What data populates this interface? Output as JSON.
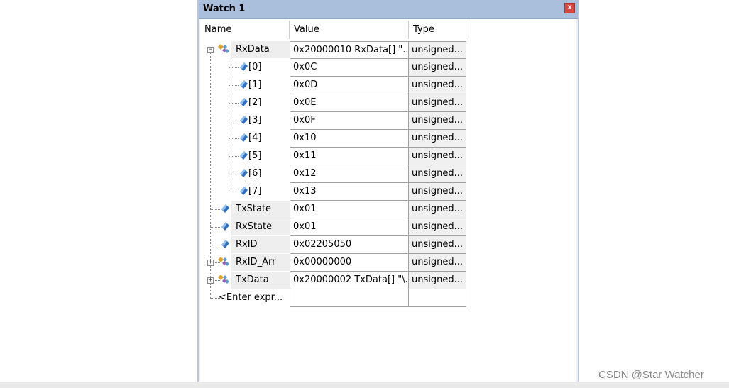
{
  "window": {
    "title": "Watch 1",
    "close_label": "x"
  },
  "columns": {
    "name": "Name",
    "value": "Value",
    "type": "Type"
  },
  "rows": [
    {
      "name": "RxData",
      "value": "0x20000010 RxData[] \"...",
      "type": "unsigned...",
      "kind": "struct",
      "level": 0,
      "expander": "minus"
    },
    {
      "name": "[0]",
      "value": "0x0C",
      "type": "unsigned...",
      "kind": "var",
      "level": 1
    },
    {
      "name": "[1]",
      "value": "0x0D",
      "type": "unsigned...",
      "kind": "var",
      "level": 1
    },
    {
      "name": "[2]",
      "value": "0x0E",
      "type": "unsigned...",
      "kind": "var",
      "level": 1
    },
    {
      "name": "[3]",
      "value": "0x0F",
      "type": "unsigned...",
      "kind": "var",
      "level": 1
    },
    {
      "name": "[4]",
      "value": "0x10",
      "type": "unsigned...",
      "kind": "var",
      "level": 1
    },
    {
      "name": "[5]",
      "value": "0x11",
      "type": "unsigned...",
      "kind": "var",
      "level": 1
    },
    {
      "name": "[6]",
      "value": "0x12",
      "type": "unsigned...",
      "kind": "var",
      "level": 1
    },
    {
      "name": "[7]",
      "value": "0x13",
      "type": "unsigned...",
      "kind": "var",
      "level": 1
    },
    {
      "name": "TxState",
      "value": "0x01",
      "type": "unsigned...",
      "kind": "var",
      "level": 0
    },
    {
      "name": "RxState",
      "value": "0x01",
      "type": "unsigned...",
      "kind": "var",
      "level": 0
    },
    {
      "name": "RxID",
      "value": "0x02205050",
      "type": "unsigned...",
      "kind": "var",
      "level": 0
    },
    {
      "name": "RxID_Arr",
      "value": "0x00000000",
      "type": "unsigned...",
      "kind": "struct",
      "level": 0,
      "expander": "plus"
    },
    {
      "name": "TxData",
      "value": "0x20000002 TxData[] \"\\...",
      "type": "unsigned...",
      "kind": "struct",
      "level": 0,
      "expander": "plus"
    },
    {
      "name": "<Enter expr...",
      "value": "",
      "type": "",
      "kind": "enter",
      "level": 0
    }
  ],
  "watermark": "CSDN @Star Watcher",
  "colors": {
    "titlebar": "#a9bfdc",
    "close_button": "#d9463d",
    "var_icon": "#2f6fc6",
    "struct_icon": "#e0a528"
  }
}
